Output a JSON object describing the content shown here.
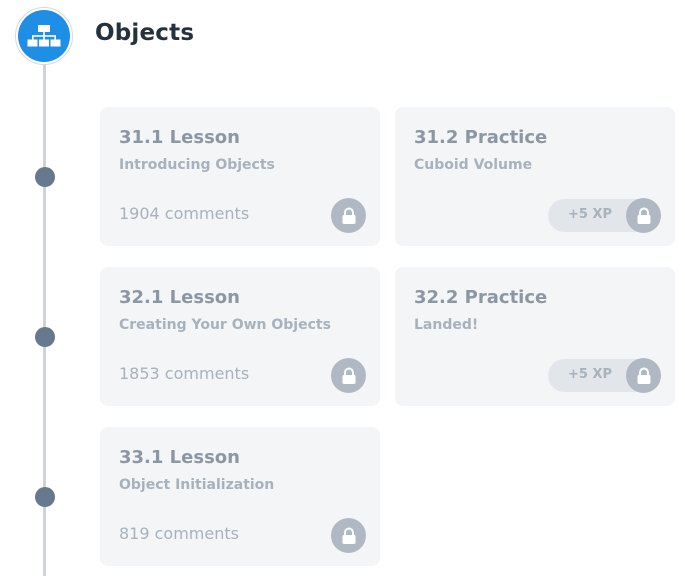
{
  "module": {
    "title": "Objects",
    "icon": "sitemap-icon",
    "accent_color": "#1f8fe5"
  },
  "cards": [
    {
      "title": "31.1 Lesson",
      "subtitle": "Introducing Objects",
      "comments": "1904 comments",
      "locked": true
    },
    {
      "title": "31.2 Practice",
      "subtitle": "Cuboid Volume",
      "xp": "+5 XP",
      "locked": true
    },
    {
      "title": "32.1 Lesson",
      "subtitle": "Creating Your Own Objects",
      "comments": "1853 comments",
      "locked": true
    },
    {
      "title": "32.2 Practice",
      "subtitle": "Landed!",
      "xp": "+5 XP",
      "locked": true
    },
    {
      "title": "33.1 Lesson",
      "subtitle": "Object Initialization",
      "comments": "819 comments",
      "locked": true
    }
  ],
  "colors": {
    "timeline_dot": "#66798f",
    "card_background": "#f3f5f7",
    "lock_badge": "#b0b9c3"
  }
}
